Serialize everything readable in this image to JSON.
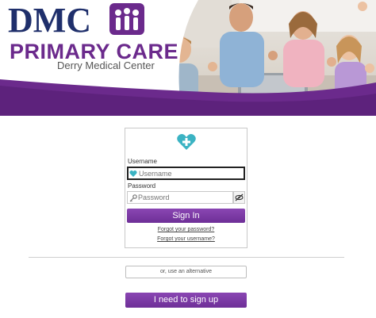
{
  "brand": {
    "name": "DMC",
    "title": "PRIMARY CARE",
    "subtitle": "Derry Medical Center",
    "colors": {
      "navy": "#1f2f6b",
      "purple": "#6b2a8c",
      "button": "#7a3aa4",
      "icon_teal": "#3bb3c3"
    }
  },
  "login": {
    "icon": "heart-plus-icon",
    "username_label": "Username",
    "username_placeholder": "Username",
    "password_label": "Password",
    "password_placeholder": "Password",
    "sign_in_label": "Sign In",
    "forgot_password": "Forgot your password?",
    "forgot_username": "Forgot your username?"
  },
  "alternative_label": "or, use an alternative",
  "signup_label": "I need to sign up"
}
